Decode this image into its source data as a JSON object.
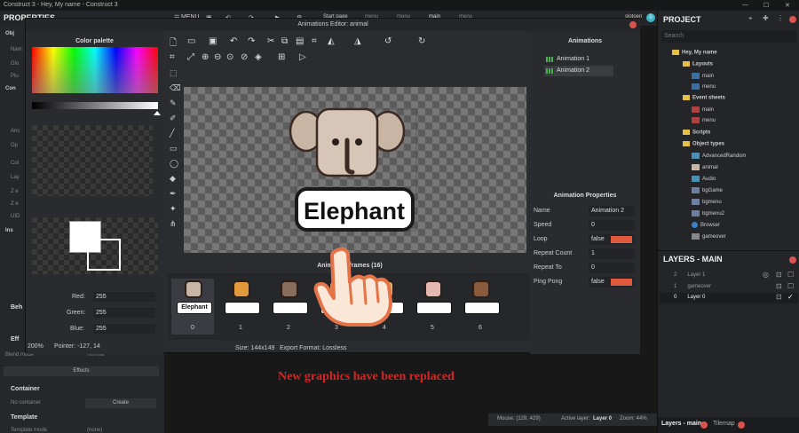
{
  "window_title": "Construct 3 - Hey, My name - Construct 3",
  "topbar": {
    "menu_label": "MENU",
    "start_page": "Start page",
    "tabs": [
      "menu",
      "menu",
      "main",
      "menu"
    ],
    "user": "slotoen",
    "user_badge": "0"
  },
  "left_panel": {
    "title": "PROPERTIES",
    "rows": [
      "Obj",
      "Nam",
      "Glo",
      "Plu",
      "Con",
      "Anc",
      "Op",
      "Col",
      "Lay",
      "Z e",
      "Z e",
      "UID",
      "Ins"
    ],
    "behaviors": "Beh",
    "effects": "Eff",
    "blend_mode_label": "Blend mode",
    "blend_mode_value": "Normal",
    "effects_button": "Effects",
    "container_header": "Container",
    "no_container": "No container",
    "create_button": "Create",
    "template_header": "Template",
    "template_mode_label": "Template mode",
    "template_mode_value": "(none)"
  },
  "dialog": {
    "title": "Animations Editor: animal",
    "color_palette": "Color palette",
    "red_label": "Red:",
    "red_value": "255",
    "green_label": "Green:",
    "green_value": "255",
    "blue_label": "Blue:",
    "blue_value": "255",
    "zoom": "200%",
    "pointer": "Pointer: -127, 14",
    "size": "Size: 144x149",
    "export_format": "Export Format: Lossless",
    "frames_title": "Animation frames (16)",
    "frames": [
      {
        "index": "0",
        "label": "Elephant",
        "color": "#c9b5a3"
      },
      {
        "index": "1",
        "label": "",
        "color": "#e09a3c"
      },
      {
        "index": "2",
        "label": "",
        "color": "#8a6c5c"
      },
      {
        "index": "3",
        "label": "",
        "color": "#c98a5a"
      },
      {
        "index": "4",
        "label": "",
        "color": "#d9b36c"
      },
      {
        "index": "5",
        "label": "",
        "color": "#e4b8b0"
      },
      {
        "index": "6",
        "label": "",
        "color": "#8a5a3c"
      }
    ],
    "canvas_label": "Elephant",
    "animations_title": "Animations",
    "animations": [
      "Animation 1",
      "Animation 2"
    ],
    "anim_props_title": "Animation Properties",
    "props": [
      {
        "label": "Name",
        "value": "Animation 2"
      },
      {
        "label": "Speed",
        "value": "0"
      },
      {
        "label": "Loop",
        "value": "false"
      },
      {
        "label": "Repeat Count",
        "value": "1"
      },
      {
        "label": "Repeat To",
        "value": "0"
      },
      {
        "label": "Ping Pong",
        "value": "false"
      }
    ]
  },
  "status": {
    "mouse": "Mouse: (128, 429)",
    "active_layer_label": "Active layer:",
    "active_layer": "Layer 0",
    "zoom": "Zoom: 44%"
  },
  "project": {
    "title": "PROJECT",
    "search_placeholder": "Search",
    "root": "Hey, My name",
    "layouts": "Layouts",
    "layout_items": [
      "main",
      "menu"
    ],
    "event_sheets": "Event sheets",
    "event_items": [
      "main",
      "menu"
    ],
    "scripts": "Scripts",
    "object_types": "Object types",
    "objects": [
      "AdvancedRandom",
      "animal",
      "Audio",
      "bgGame",
      "bgmenu",
      "bgmenu2",
      "Browser",
      "gameover"
    ]
  },
  "layers": {
    "title": "LAYERS - MAIN",
    "items": [
      {
        "num": "2",
        "name": "Layer 1"
      },
      {
        "num": "1",
        "name": "gameover"
      },
      {
        "num": "0",
        "name": "Layer 0"
      }
    ],
    "bottom_tabs": [
      "Layers - main",
      "Tilemap"
    ]
  },
  "caption": "New graphics have been replaced"
}
